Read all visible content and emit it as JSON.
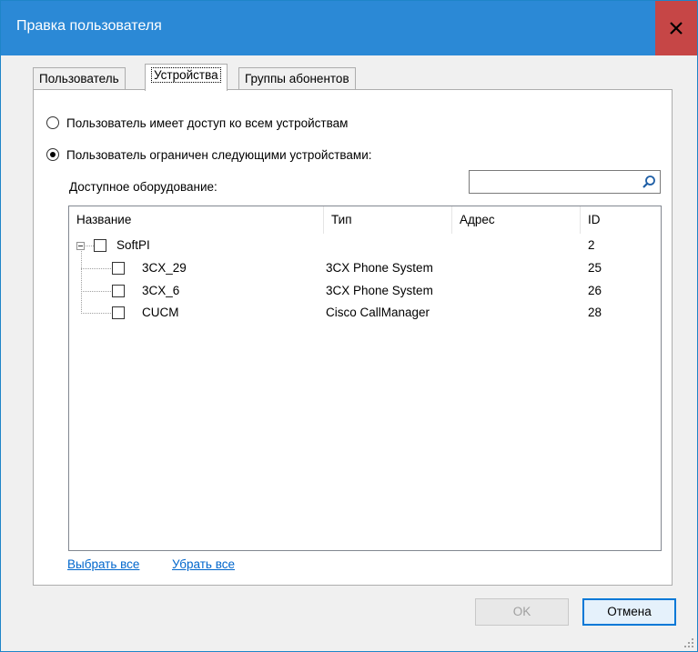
{
  "window": {
    "title": "Правка пользователя"
  },
  "tabs": [
    {
      "label": "Пользователь",
      "active": false
    },
    {
      "label": "Устройства",
      "active": true
    },
    {
      "label": "Группы абонентов",
      "active": false
    }
  ],
  "access": {
    "option_all": "Пользователь имеет доступ ко всем устройствам",
    "option_restricted": "Пользователь ограничен следующими устройствами:",
    "selected": "restricted"
  },
  "equipment": {
    "label": "Доступное оборудование:",
    "search_value": "",
    "columns": [
      "Название",
      "Тип",
      "Адрес",
      "ID"
    ],
    "root": {
      "name": "SoftPI",
      "type": "",
      "address": "",
      "id": "2",
      "expanded": true,
      "checked": false
    },
    "children": [
      {
        "name": "3CX_29",
        "type": "3CX Phone System",
        "address": "",
        "id": "25",
        "checked": false
      },
      {
        "name": "3CX_6",
        "type": "3CX Phone System",
        "address": "",
        "id": "26",
        "checked": false
      },
      {
        "name": "CUCM",
        "type": "Cisco CallManager",
        "address": "",
        "id": "28",
        "checked": false
      }
    ]
  },
  "links": {
    "select_all": "Выбрать все",
    "clear_all": "Убрать все"
  },
  "buttons": {
    "ok": "OK",
    "cancel": "Отмена"
  },
  "icons": {
    "close": "close-icon",
    "search": "search-icon",
    "grip": "resize-grip-icon"
  },
  "colors": {
    "titlebar": "#2b89d6",
    "close": "#c64646",
    "link": "#0066cc"
  }
}
